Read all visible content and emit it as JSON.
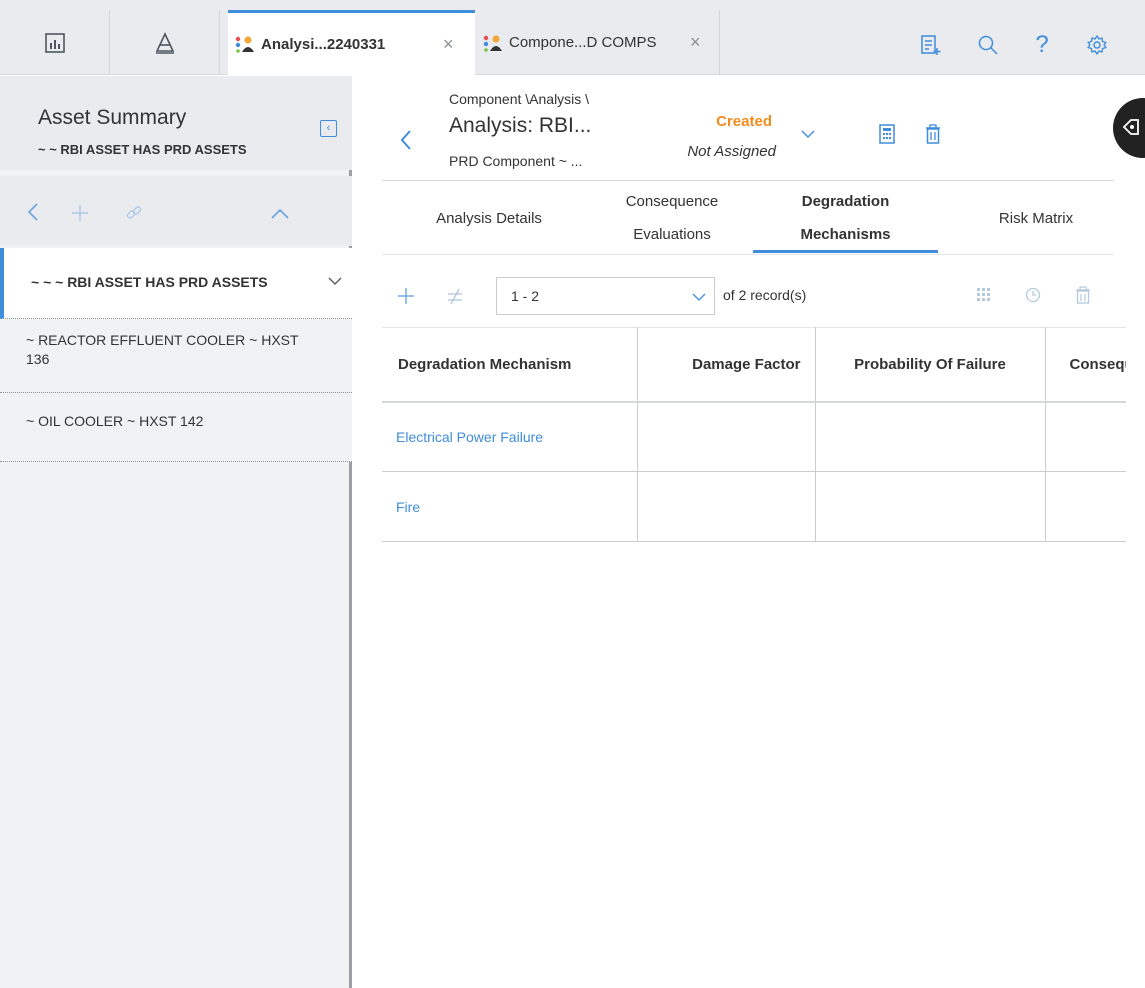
{
  "tabs": [
    {
      "label": "Analysi...2240331",
      "active": true
    },
    {
      "label": "Compone...D COMPS",
      "active": false
    }
  ],
  "nav": {
    "dashboard_icon": "bar-chart-icon",
    "hierarchy_icon": "pyramid-icon"
  },
  "top_icons": [
    "checklist-add-icon",
    "search-icon",
    "help-icon",
    "gear-icon"
  ],
  "asset_summary": {
    "title": "Asset Summary",
    "subtitle": "~ ~ RBI ASSET HAS PRD ASSETS"
  },
  "tree": [
    {
      "label": "~ ~ ~ RBI ASSET HAS PRD ASSETS",
      "selected": true
    },
    {
      "label": "~ REACTOR EFFLUENT COOLER ~ HXST 136",
      "selected": false
    },
    {
      "label": "~ OIL COOLER ~ HXST 142",
      "selected": false
    }
  ],
  "analysis": {
    "breadcrumb": "Component \\Analysis \\",
    "title": "Analysis: RBI...",
    "subtitle": "PRD Component ~ ...",
    "state": "Created",
    "assignment": "Not Assigned"
  },
  "content_tabs": [
    {
      "line1": "Analysis Details",
      "line2": "",
      "active": false
    },
    {
      "line1": "Consequence",
      "line2": "Evaluations",
      "active": false
    },
    {
      "line1": "Degradation",
      "line2": "Mechanisms",
      "active": true
    },
    {
      "line1": "Risk Matrix",
      "line2": "",
      "active": false
    }
  ],
  "records": {
    "range": "1 - 2",
    "count_text": "of 2 record(s)"
  },
  "grid": {
    "columns": [
      "Degradation Mechanism",
      "Damage Factor",
      "Probability Of Failure",
      "Consequ"
    ],
    "rows": [
      [
        "Electrical Power Failure",
        "",
        "",
        ""
      ],
      [
        "Fire",
        "",
        "",
        ""
      ]
    ]
  },
  "colors": {
    "accent": "#3f8ddb",
    "state_created": "#f28c1f"
  }
}
